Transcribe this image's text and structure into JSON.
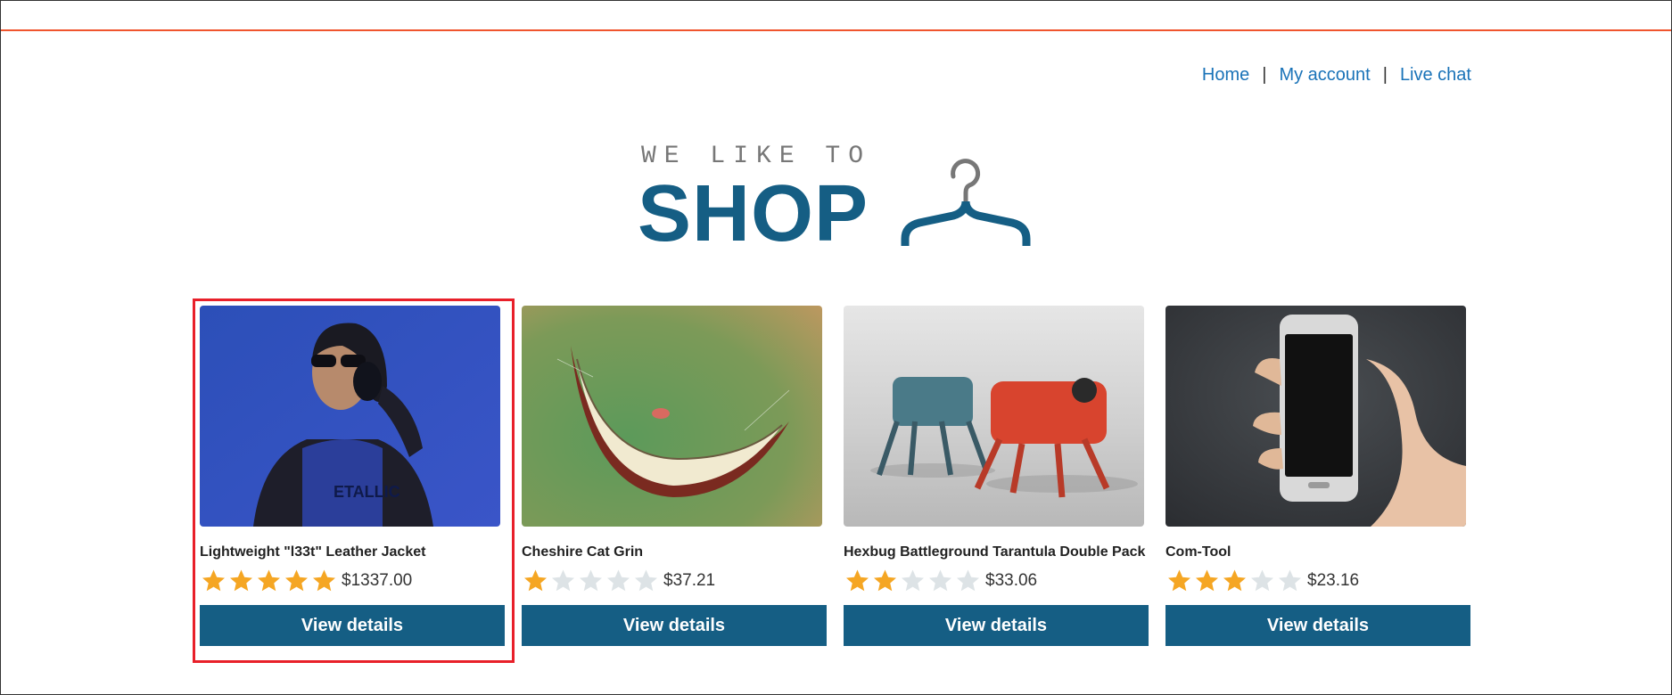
{
  "nav": {
    "items": [
      {
        "label": "Home"
      },
      {
        "label": "My account"
      },
      {
        "label": "Live chat"
      }
    ],
    "separator": "|"
  },
  "logo": {
    "tagline": "WE LIKE TO",
    "wordmark": "SHOP",
    "icon": "hanger-icon"
  },
  "products": [
    {
      "title": "Lightweight \"l33t\" Leather Jacket",
      "rating": 5,
      "price": "$1337.00",
      "button": "View details",
      "image": "woman with headphones"
    },
    {
      "title": "Cheshire Cat Grin",
      "rating": 1,
      "price": "$37.21",
      "button": "View details",
      "image": "cheshire grin"
    },
    {
      "title": "Hexbug Battleground Tarantula Double Pack",
      "rating": 2,
      "price": "$33.06",
      "button": "View details",
      "image": "robot spiders"
    },
    {
      "title": "Com-Tool",
      "rating": 3,
      "price": "$23.16",
      "button": "View details",
      "image": "hand holding phone"
    }
  ],
  "colors": {
    "accent_rule": "#f0552e",
    "brand": "#155e84",
    "link": "#1a73b8",
    "star_on": "#f5a623",
    "star_off": "#dde3e6",
    "highlight": "#e8202a"
  }
}
